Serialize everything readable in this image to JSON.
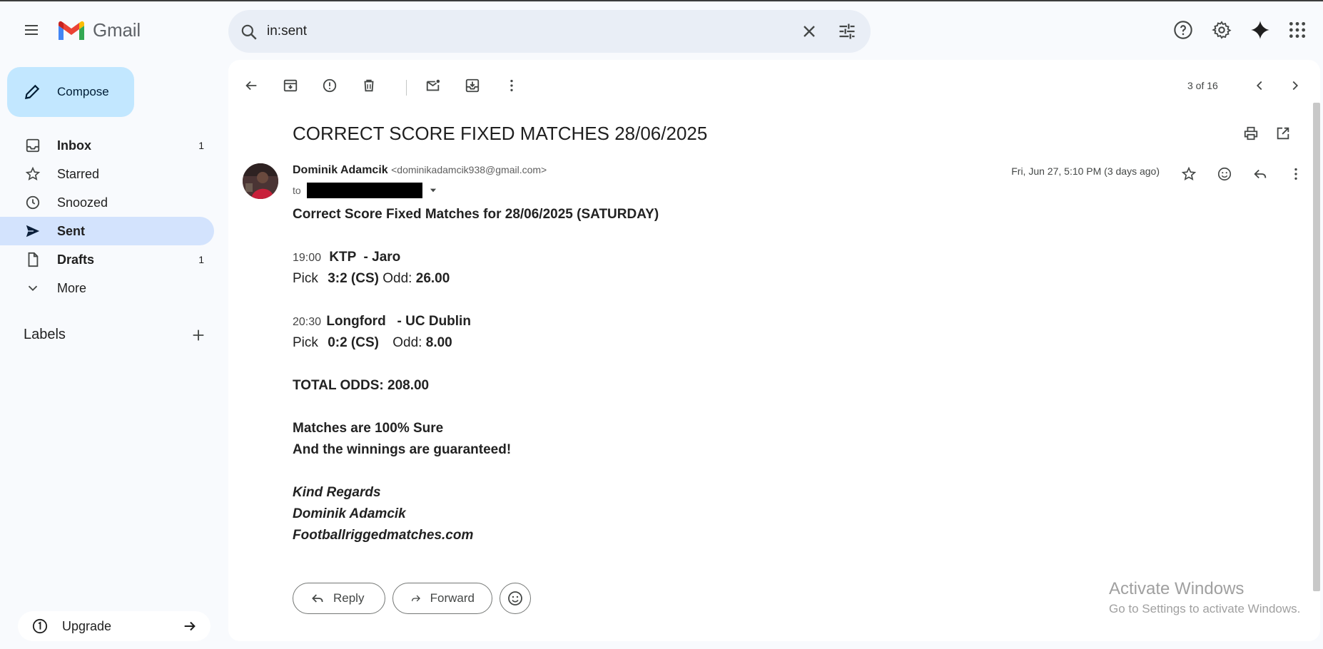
{
  "app": {
    "name": "Gmail"
  },
  "search": {
    "value": "in:sent"
  },
  "compose": {
    "label": "Compose"
  },
  "sidebar": {
    "items": [
      {
        "label": "Inbox",
        "count": "1",
        "icon": "inbox-icon"
      },
      {
        "label": "Starred",
        "count": "",
        "icon": "star-icon"
      },
      {
        "label": "Snoozed",
        "count": "",
        "icon": "clock-icon"
      },
      {
        "label": "Sent",
        "count": "",
        "icon": "send-icon"
      },
      {
        "label": "Drafts",
        "count": "1",
        "icon": "draft-icon"
      },
      {
        "label": "More",
        "count": "",
        "icon": "chevron-down-icon"
      }
    ],
    "labels_heading": "Labels",
    "upgrade": "Upgrade"
  },
  "toolbar": {
    "pager": "3 of 16"
  },
  "message": {
    "subject": "CORRECT SCORE FIXED MATCHES 28/06/2025",
    "sender_name": "Dominik Adamcik",
    "sender_email": "<dominikadamcik938@gmail.com>",
    "to_label": "to",
    "date": "Fri, Jun 27, 5:10 PM (3 days ago)",
    "body": {
      "heading": "Correct Score Fixed Matches for 28/06/2025 (SATURDAY)",
      "match1_time": "19:00",
      "match1_teams": "KTP  - Jaro",
      "match1_pick_label": "Pick",
      "match1_pick": "3:2 (CS)",
      "match1_odd_label": "Odd:",
      "match1_odd": "26.00",
      "match2_time": "20:30",
      "match2_teams": "Longford   - UC Dublin",
      "match2_pick_label": "Pick",
      "match2_pick": "0:2 (CS)",
      "match2_odd_label": "Odd:",
      "match2_odd": "8.00",
      "total": "TOTAL ODDS: 208.00",
      "sure": "Matches are 100% Sure",
      "guaranteed": "And the winnings are guaranteed!",
      "regards": "Kind Regards",
      "sig_name": "Dominik Adamcik",
      "sig_site": "Footballriggedmatches.com"
    },
    "reply_label": "Reply",
    "forward_label": "Forward"
  },
  "watermark": {
    "title": "Activate Windows",
    "subtitle": "Go to Settings to activate Windows."
  },
  "colors": {
    "accent": "#c2e7ff",
    "active_nav": "#d3e3fd",
    "background": "#f8fafd"
  }
}
